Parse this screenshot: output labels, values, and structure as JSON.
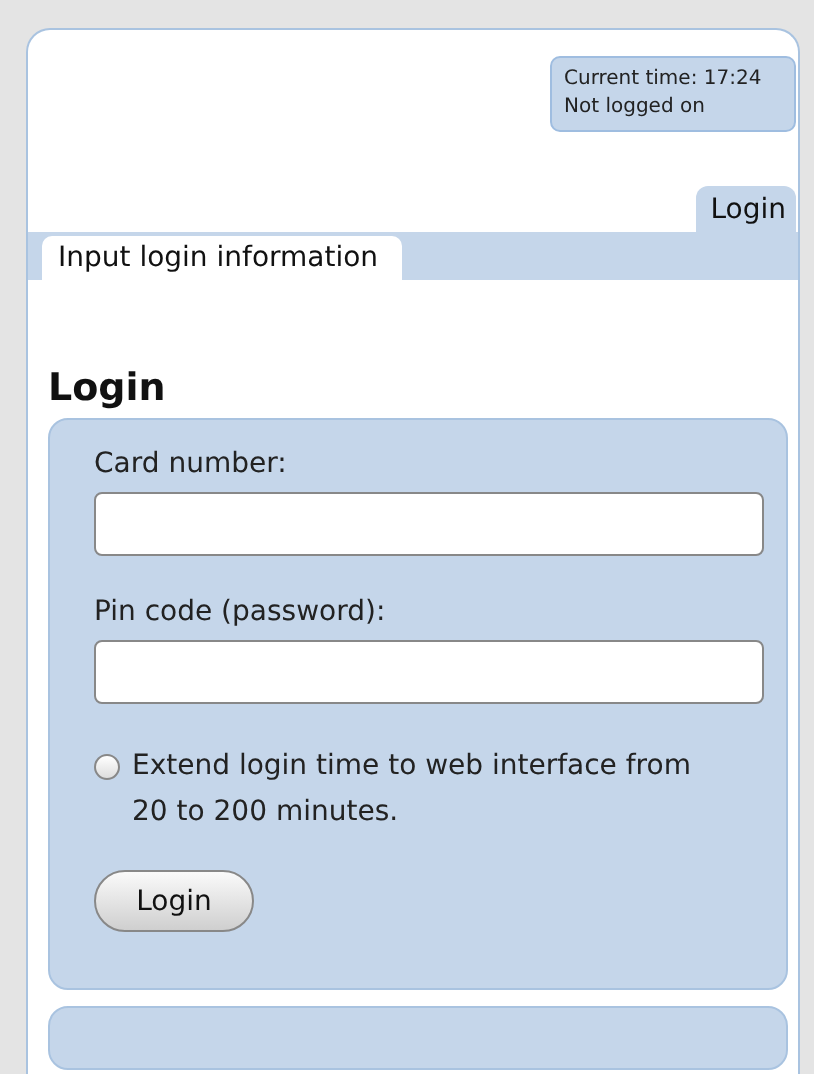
{
  "status": {
    "time": "Current time: 17:24",
    "login_state": "Not logged on"
  },
  "tabs": [
    {
      "label": "Login",
      "selected": true
    }
  ],
  "subtabs": [
    {
      "label": "Input login information",
      "selected": true
    }
  ],
  "heading": "Login",
  "form": {
    "fields": [
      {
        "label": "Card number:"
      },
      {
        "label": "Pin code (password):"
      }
    ],
    "extend": {
      "label": "Extend login time to web interface from 20 to 200 minutes.",
      "checked": false
    },
    "button": "Login"
  }
}
